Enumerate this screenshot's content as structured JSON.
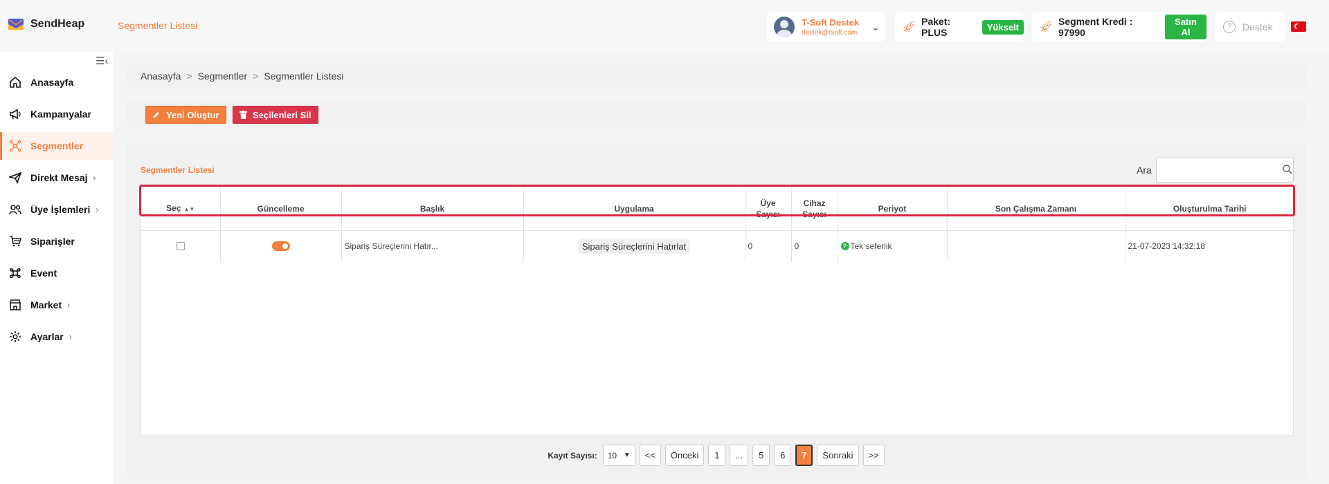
{
  "app": {
    "name": "SendHeap"
  },
  "header": {
    "page_title": "Segmentler Listesi",
    "user": {
      "name": "T-Soft Destek",
      "email": "destek@tsoft.com"
    },
    "package": {
      "label": "Paket: PLUS",
      "upgrade": "Yükselt"
    },
    "credit": {
      "label": "Segment Kredi : 97990",
      "buy": "Satın Al"
    },
    "support": "Destek"
  },
  "sidebar": {
    "items": [
      {
        "label": "Anasayfa",
        "icon": "home-icon",
        "active": false,
        "has_submenu": false
      },
      {
        "label": "Kampanyalar",
        "icon": "megaphone-icon",
        "active": false,
        "has_submenu": false
      },
      {
        "label": "Segmentler",
        "icon": "segment-network-icon",
        "active": true,
        "has_submenu": false
      },
      {
        "label": "Direkt Mesaj",
        "icon": "send-icon",
        "active": false,
        "has_submenu": true
      },
      {
        "label": "Üye İşlemleri",
        "icon": "users-icon",
        "active": false,
        "has_submenu": true
      },
      {
        "label": "Siparişler",
        "icon": "cart-icon",
        "active": false,
        "has_submenu": false
      },
      {
        "label": "Event",
        "icon": "command-icon",
        "active": false,
        "has_submenu": false
      },
      {
        "label": "Market",
        "icon": "store-icon",
        "active": false,
        "has_submenu": true
      },
      {
        "label": "Ayarlar",
        "icon": "gear-icon",
        "active": false,
        "has_submenu": true
      }
    ]
  },
  "breadcrumb": [
    "Anasayfa",
    "Segmentler",
    "Segmentler Listesi"
  ],
  "actions": {
    "new": "Yeni Oluştur",
    "delete_selected": "Seçilenleri Sil"
  },
  "list": {
    "title": "Segmentler Listesi",
    "search_label": "Ara",
    "search_value": "",
    "columns": [
      "Seç",
      "Güncelleme",
      "Başlık",
      "Uygulama",
      "Üye Sayısı",
      "Cihaz Sayısı",
      "Periyot",
      "Son Çalışma Zamanı",
      "Oluşturulma Tarihi"
    ],
    "rows": [
      {
        "selected": false,
        "update_enabled": true,
        "title": "Sipariş Süreçlerini Hatır...",
        "application": "Sipariş Süreçlerini Hatırlat",
        "member_count": "0",
        "device_count": "0",
        "period": "Tek seferlik",
        "last_run": "",
        "created_at": "21-07-2023 14:32:18"
      }
    ]
  },
  "pagination": {
    "label": "Kayıt Sayısı:",
    "page_size": "10",
    "first": "<<",
    "prev": "Önceki",
    "pages": [
      "1",
      "...",
      "5",
      "6",
      "7"
    ],
    "current": "7",
    "next": "Sonraki",
    "last": ">>"
  },
  "colors": {
    "accent": "#f27f3d",
    "success": "#2bb547",
    "danger": "#d9354a",
    "highlight": "#d9283b"
  }
}
